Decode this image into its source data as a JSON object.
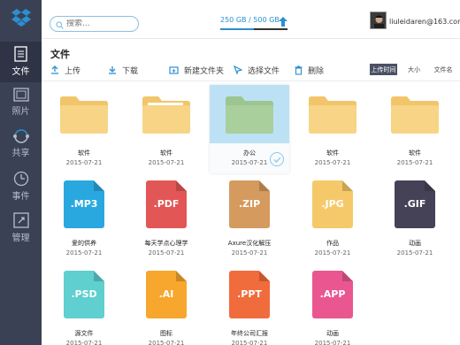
{
  "sidebar": {
    "items": [
      {
        "label": "文件",
        "icon": "document-icon",
        "active": true
      },
      {
        "label": "照片",
        "icon": "photo-icon"
      },
      {
        "label": "共享",
        "icon": "share-icon"
      },
      {
        "label": "事件",
        "icon": "clock-icon"
      },
      {
        "label": "管理",
        "icon": "manage-icon"
      }
    ]
  },
  "header": {
    "search_placeholder": "搜索...",
    "storage": "250 GB / 500 GB",
    "storage_used_fraction": 0.5,
    "username": "liuleidaren@163.com"
  },
  "page": {
    "title": "文件"
  },
  "toolbar": {
    "upload": "上传",
    "download": "下载",
    "new_folder": "新建文件夹",
    "select_file": "选择文件",
    "delete": "删除"
  },
  "sort": {
    "by_time": "上传时间",
    "by_size": "大小",
    "by_name": "文件名"
  },
  "colors": {
    "sidebar": "#3a4154",
    "accent": "#2b8fd1",
    "folder": "#f7d486",
    "selected_bg": "#bde1f4"
  },
  "files": [
    {
      "kind": "folder",
      "name": "软件",
      "date": "2015-07-21"
    },
    {
      "kind": "folder",
      "name": "软件",
      "date": "2015-07-21"
    },
    {
      "kind": "folder",
      "name": "办公",
      "date": "2015-07-21",
      "selected": true
    },
    {
      "kind": "folder",
      "name": "软件",
      "date": "2015-07-21"
    },
    {
      "kind": "folder",
      "name": "软件",
      "date": "2015-07-21"
    },
    {
      "kind": "file",
      "ext": ".MP3",
      "color": "#29a8e0",
      "name": "爱的供养",
      "date": "2015-07-21"
    },
    {
      "kind": "file",
      "ext": ".PDF",
      "color": "#e35656",
      "name": "每天学点心理学",
      "date": "2015-07-21"
    },
    {
      "kind": "file",
      "ext": ".ZIP",
      "color": "#d49a5e",
      "name": "Axure汉化解压",
      "date": "2015-07-21"
    },
    {
      "kind": "file",
      "ext": ".JPG",
      "color": "#f5c96a",
      "name": "作品",
      "date": "2015-07-21"
    },
    {
      "kind": "file",
      "ext": ".GIF",
      "color": "#454257",
      "name": "动画",
      "date": "2015-07-21"
    },
    {
      "kind": "file",
      "ext": ".PSD",
      "color": "#5fcfcf",
      "name": "源文件",
      "date": "2015-07-21"
    },
    {
      "kind": "file",
      "ext": ".AI",
      "color": "#f7a72d",
      "name": "图标",
      "date": "2015-07-21"
    },
    {
      "kind": "file",
      "ext": ".PPT",
      "color": "#f06c3c",
      "name": "年终公司汇报",
      "date": "2015-07-21"
    },
    {
      "kind": "file",
      "ext": ".APP",
      "color": "#ea5790",
      "name": "动画",
      "date": "2015-07-21"
    }
  ]
}
